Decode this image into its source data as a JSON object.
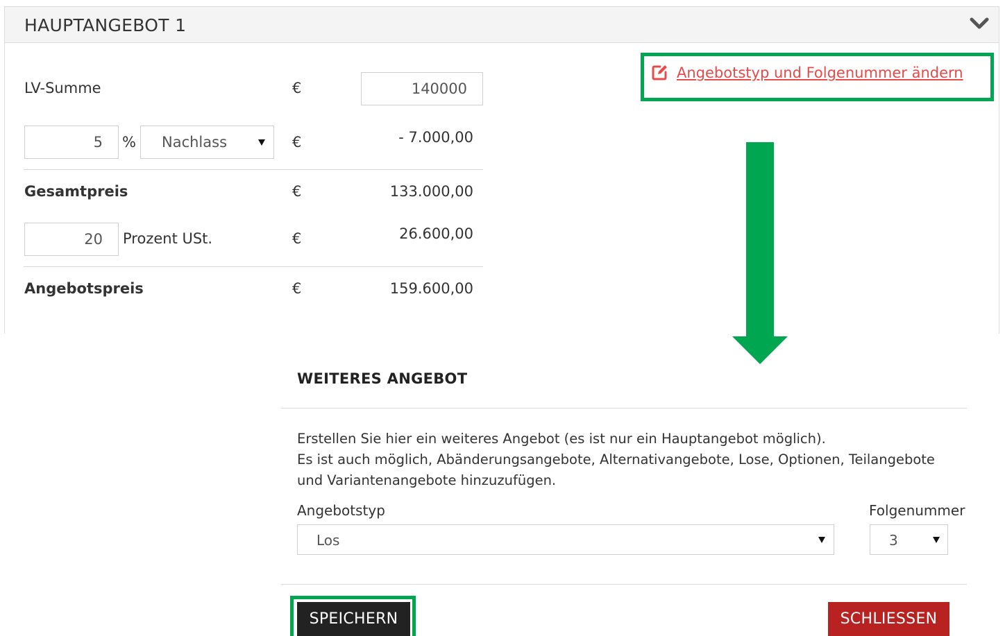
{
  "panel": {
    "title": "HAUPTANGEBOT 1",
    "edit_link": "Angebotstyp und Folgenummer ändern",
    "lv_summe": {
      "label": "LV-Summe",
      "currency": "€",
      "value": "140000"
    },
    "discount": {
      "percent": "5",
      "percent_sign": "%",
      "type": "Nachlass",
      "currency": "€",
      "amount": "- 7.000,00"
    },
    "gesamtpreis": {
      "label": "Gesamtpreis",
      "currency": "€",
      "amount": "133.000,00"
    },
    "vat": {
      "percent": "20",
      "label": "Prozent USt.",
      "currency": "€",
      "amount": "26.600,00"
    },
    "angebotspreis": {
      "label": "Angebotspreis",
      "currency": "€",
      "amount": "159.600,00"
    }
  },
  "modal": {
    "title": "WEITERES ANGEBOT",
    "description_line1": "Erstellen Sie hier ein weiteres Angebot (es ist nur ein Hauptangebot möglich).",
    "description_line2": "Es ist auch möglich, Abänderungsangebote, Alternativangebote, Lose, Optionen, Teilangebote und Variantenangebote hinzuzufügen.",
    "angebotstyp_label": "Angebotstyp",
    "angebotstyp_value": "Los",
    "folgenummer_label": "Folgenummer",
    "folgenummer_value": "3",
    "save_label": "SPEICHERN",
    "close_label": "SCHLIESSEN"
  },
  "colors": {
    "highlight": "#00a650",
    "link": "#e84a4a",
    "close_button": "#b82220",
    "save_button": "#222222"
  },
  "icons": [
    "chevron-down-icon",
    "edit-icon",
    "caret-down-icon",
    "arrow-down-icon"
  ]
}
